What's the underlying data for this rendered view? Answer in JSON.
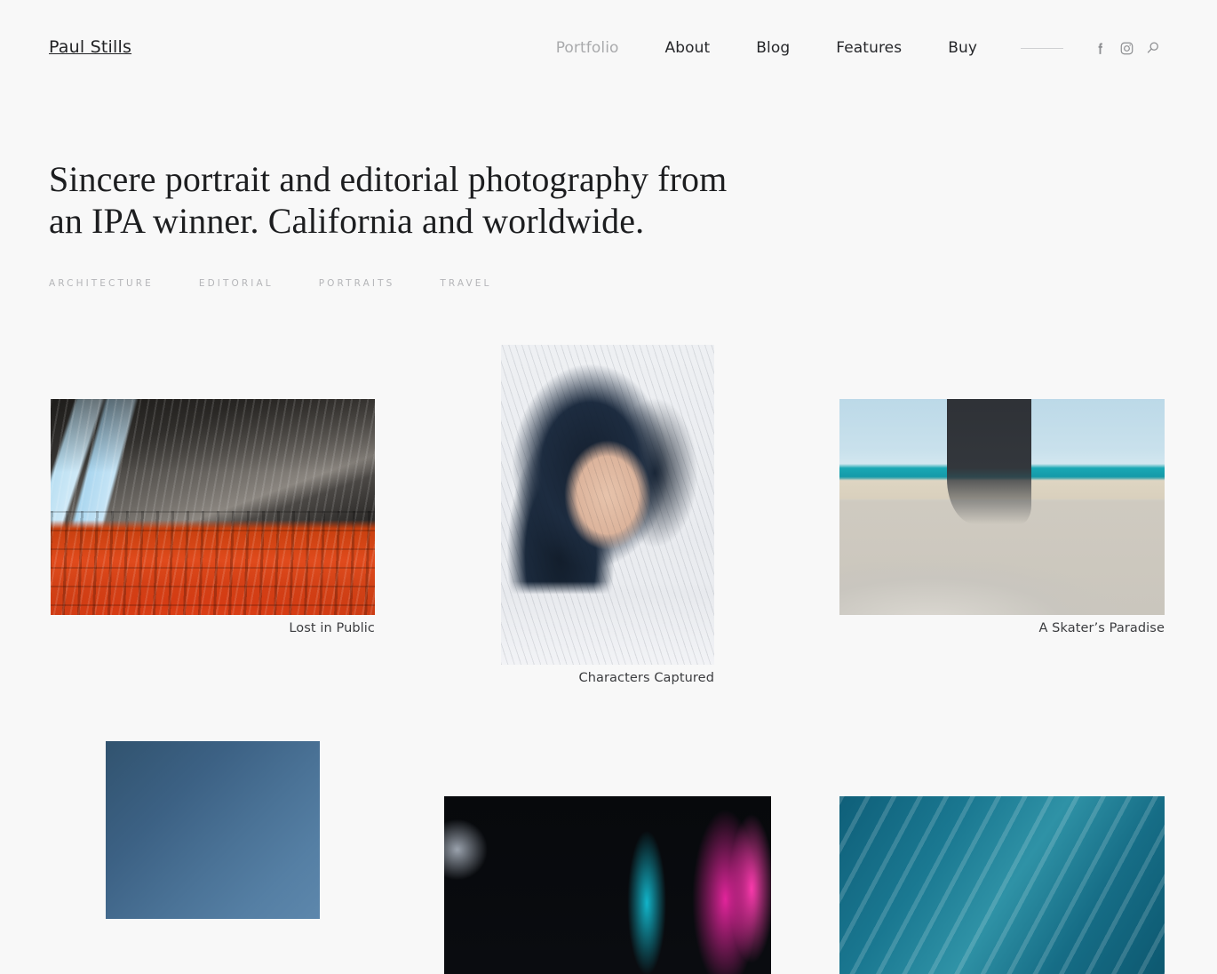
{
  "site": {
    "brand": "Paul Stills",
    "background_color": "#f8f8f8"
  },
  "header": {
    "nav": [
      {
        "label": "Portfolio",
        "active": true
      },
      {
        "label": "About",
        "active": false
      },
      {
        "label": "Blog",
        "active": false
      },
      {
        "label": "Features",
        "active": false
      },
      {
        "label": "Buy",
        "active": false
      }
    ],
    "social": [
      {
        "name": "facebook-icon",
        "label": "Facebook"
      },
      {
        "name": "instagram-icon",
        "label": "Instagram"
      }
    ],
    "search": {
      "name": "search-icon",
      "label": "Search"
    },
    "divider": true,
    "active_link_color": "#a9aaac",
    "link_color": "#26272a"
  },
  "hero": {
    "title_line_1": "Sincere portrait and editorial photography from",
    "title_line_2": "an IPA winner. California and worldwide.",
    "title_color": "#1d1e20"
  },
  "categories": [
    {
      "label": "Architecture"
    },
    {
      "label": "Editorial"
    },
    {
      "label": "Portraits"
    },
    {
      "label": "Travel"
    }
  ],
  "gallery": {
    "items": [
      {
        "caption": "Lost in Public",
        "subject": "stadium-seating-architecture"
      },
      {
        "caption": "Characters Captured",
        "subject": "woman-portrait"
      },
      {
        "caption": "A Skater’s Paradise",
        "subject": "skatepark-beach"
      },
      {
        "caption": "",
        "subject": "blue-gradient"
      },
      {
        "caption": "",
        "subject": "neon-night"
      },
      {
        "caption": "",
        "subject": "teal-water"
      }
    ]
  }
}
